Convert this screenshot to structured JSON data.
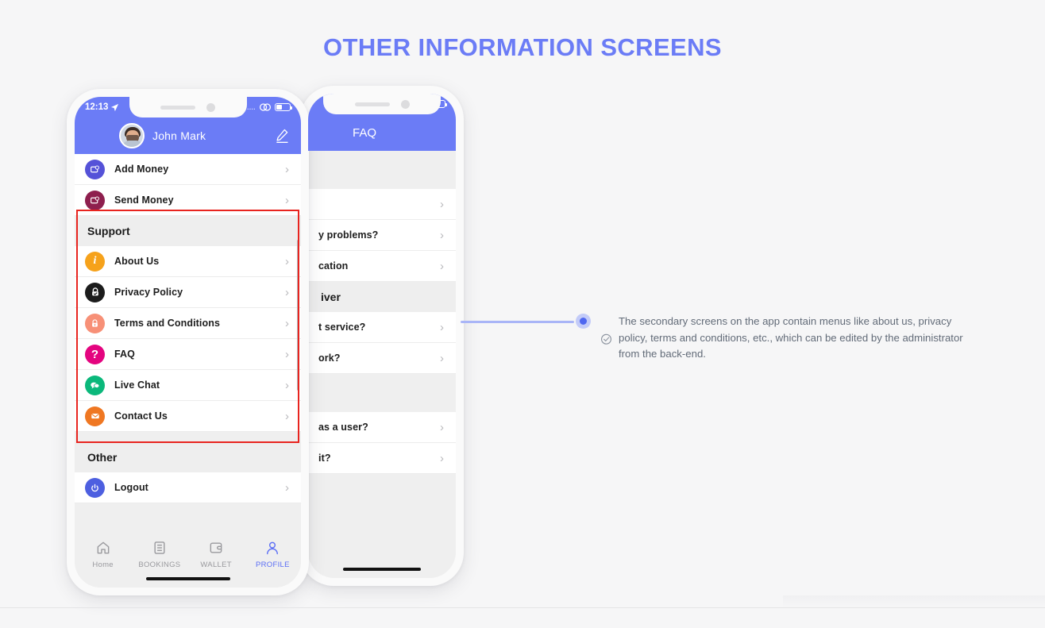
{
  "page": {
    "title": "OTHER INFORMATION SCREENS",
    "title_color": "#6b7cf6",
    "background": "#f6f6f7"
  },
  "phone_front": {
    "status_bar": {
      "time": "12:13",
      "location_icon": "location-arrow-icon",
      "dots": "....",
      "link_icon": "link-icon",
      "battery_icon": "battery-icon"
    },
    "header": {
      "accent_color": "#6b7cf6",
      "user_name": "John Mark",
      "avatar": "user-avatar",
      "edit_icon": "pencil-edit-icon"
    },
    "menu": [
      {
        "type": "row",
        "label": "Add Money",
        "icon": "add-money-icon",
        "color": "#5552d8"
      },
      {
        "type": "row",
        "label": "Send Money",
        "icon": "send-money-icon",
        "color": "#8e1f4e"
      },
      {
        "type": "header",
        "label": "Support"
      },
      {
        "type": "row",
        "label": "About Us",
        "icon": "info-icon",
        "color": "#f6a21b",
        "glyph": "i"
      },
      {
        "type": "row",
        "label": "Privacy Policy",
        "icon": "privacy-lock-icon",
        "color": "#1c1c1c"
      },
      {
        "type": "row",
        "label": "Terms and Conditions",
        "icon": "lock-icon",
        "color": "#f79077"
      },
      {
        "type": "row",
        "label": "FAQ",
        "icon": "question-icon",
        "color": "#e4047f",
        "glyph": "?"
      },
      {
        "type": "row",
        "label": "Live Chat",
        "icon": "chat-bubble-icon",
        "color": "#0bb87b"
      },
      {
        "type": "row",
        "label": "Contact Us",
        "icon": "envelope-icon",
        "color": "#ef7722"
      },
      {
        "type": "header",
        "label": "Other"
      },
      {
        "type": "row",
        "label": "Logout",
        "icon": "power-icon",
        "color": "#4d5fe0"
      }
    ],
    "chevron": "›",
    "tabbar": [
      {
        "label": "Home",
        "icon": "home-icon",
        "active": false
      },
      {
        "label": "BOOKINGS",
        "icon": "bookings-list-icon",
        "active": false
      },
      {
        "label": "WALLET",
        "icon": "wallet-icon",
        "active": false
      },
      {
        "label": "PROFILE",
        "icon": "profile-person-icon",
        "active": true
      }
    ]
  },
  "phone_back": {
    "status_bar": {
      "dots": "....",
      "link_icon": "link-icon",
      "battery_icon": "battery-icon"
    },
    "header": {
      "title": "FAQ",
      "accent_color": "#6b7cf6"
    },
    "faq_rows": [
      {
        "type": "gap"
      },
      {
        "type": "row",
        "label": ""
      },
      {
        "type": "row",
        "label": "y problems?"
      },
      {
        "type": "row",
        "label": "cation"
      },
      {
        "type": "header",
        "label": "iver"
      },
      {
        "type": "row",
        "label": "t service?"
      },
      {
        "type": "row",
        "label": "ork?"
      },
      {
        "type": "gap"
      },
      {
        "type": "row",
        "label": "as a user?"
      },
      {
        "type": "row",
        "label": "it?"
      }
    ],
    "chevron": "›"
  },
  "highlight": {
    "name": "support-section-highlight",
    "color": "#e8241f"
  },
  "annotation": {
    "dot_color": "#4f67f0",
    "line_color": "#a9b5f7",
    "check_icon": "check-circle-icon",
    "text": "The secondary screens on the app contain menus like about us, privacy policy, terms and conditions, etc., which can be edited by the administrator from the back-end."
  }
}
